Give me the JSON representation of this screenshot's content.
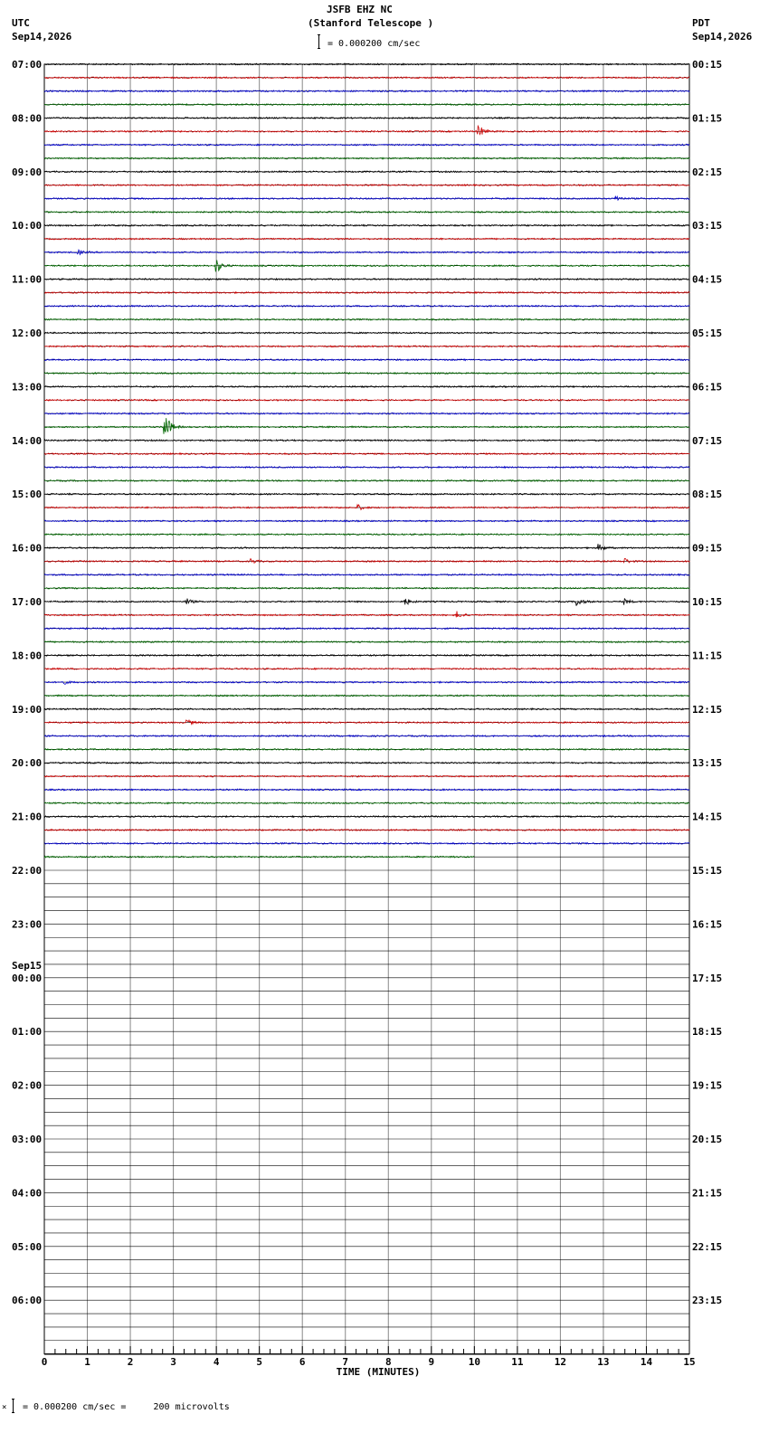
{
  "header": {
    "station": "JSFB EHZ NC",
    "site": "(Stanford Telescope )",
    "scale": "= 0.000200 cm/sec",
    "left_tz": "UTC",
    "left_date": "Sep14,2026",
    "right_tz": "PDT",
    "right_date": "Sep14,2026"
  },
  "footer": {
    "scale_note": "= 0.000200 cm/sec =     200 microvolts"
  },
  "chart_data": {
    "type": "line",
    "title": "JSFB EHZ NC (Stanford Telescope )",
    "xlabel": "TIME (MINUTES)",
    "x_ticks": [
      "0",
      "1",
      "2",
      "3",
      "4",
      "5",
      "6",
      "7",
      "8",
      "9",
      "10",
      "11",
      "12",
      "13",
      "14",
      "15"
    ],
    "xlim": [
      0,
      15
    ],
    "grid": true,
    "rows_per_hour": 4,
    "total_rows": 96,
    "recorded_rows": 60,
    "last_row_end_minute": 10,
    "left_hour_labels": [
      "07:00",
      "08:00",
      "09:00",
      "10:00",
      "11:00",
      "12:00",
      "13:00",
      "14:00",
      "15:00",
      "16:00",
      "17:00",
      "18:00",
      "19:00",
      "20:00",
      "21:00",
      "22:00",
      "23:00",
      "00:00",
      "01:00",
      "02:00",
      "03:00",
      "04:00",
      "05:00",
      "06:00"
    ],
    "day_change_label": "Sep15",
    "day_change_hour_index": 17,
    "right_hour_labels": [
      "00:15",
      "01:15",
      "02:15",
      "03:15",
      "04:15",
      "05:15",
      "06:15",
      "07:15",
      "08:15",
      "09:15",
      "10:15",
      "11:15",
      "12:15",
      "13:15",
      "14:15",
      "15:15",
      "16:15",
      "17:15",
      "18:15",
      "19:15",
      "20:15",
      "21:15",
      "22:15",
      "23:15"
    ],
    "trace_colors": [
      "#000000",
      "#cc0000",
      "#0000cc",
      "#006600"
    ],
    "events": [
      {
        "row": 5,
        "minute": 10.1,
        "amp": 1.2
      },
      {
        "row": 10,
        "minute": 13.3,
        "amp": 0.6
      },
      {
        "row": 14,
        "minute": 0.8,
        "amp": 0.4
      },
      {
        "row": 15,
        "minute": 4.0,
        "amp": 1.4
      },
      {
        "row": 27,
        "minute": 2.8,
        "amp": 3.0
      },
      {
        "row": 33,
        "minute": 7.3,
        "amp": 0.5
      },
      {
        "row": 36,
        "minute": 12.9,
        "amp": 0.6
      },
      {
        "row": 37,
        "minute": 4.8,
        "amp": 0.5
      },
      {
        "row": 37,
        "minute": 13.5,
        "amp": 0.5
      },
      {
        "row": 40,
        "minute": 3.3,
        "amp": 0.6
      },
      {
        "row": 40,
        "minute": 8.4,
        "amp": 0.6
      },
      {
        "row": 40,
        "minute": 12.4,
        "amp": 0.8
      },
      {
        "row": 40,
        "minute": 13.5,
        "amp": 0.5
      },
      {
        "row": 41,
        "minute": 9.6,
        "amp": 0.6
      },
      {
        "row": 46,
        "minute": 0.4,
        "amp": 0.5
      },
      {
        "row": 49,
        "minute": 3.3,
        "amp": 0.6
      }
    ]
  }
}
